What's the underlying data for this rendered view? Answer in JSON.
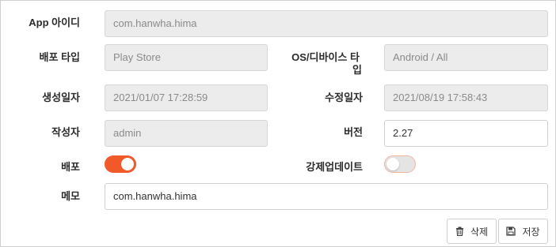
{
  "form": {
    "app_id": {
      "label": "App 아이디",
      "value": "com.hanwha.hima"
    },
    "deploy_type": {
      "label": "배포 타입",
      "value": "Play Store"
    },
    "os_device_type": {
      "label_line1": "OS/디바이스 타",
      "label_line2": "입",
      "value": "Android / All"
    },
    "created_at": {
      "label": "생성일자",
      "value": "2021/01/07 17:28:59"
    },
    "modified_at": {
      "label": "수정일자",
      "value": "2021/08/19 17:58:43"
    },
    "author": {
      "label": "작성자",
      "value": "admin"
    },
    "version": {
      "label": "버전",
      "value": "2.27"
    },
    "deploy": {
      "label": "배포",
      "enabled": true
    },
    "force_update": {
      "label": "강제업데이트",
      "enabled": false
    },
    "memo": {
      "label": "메모",
      "value": "com.hanwha.hima"
    }
  },
  "actions": {
    "delete_label": "삭제",
    "save_label": "저장"
  },
  "colors": {
    "accent": "#f05a28",
    "readonly_bg": "#ececec"
  },
  "icons": {
    "delete": "trash-icon",
    "save": "floppy-disk-icon"
  }
}
